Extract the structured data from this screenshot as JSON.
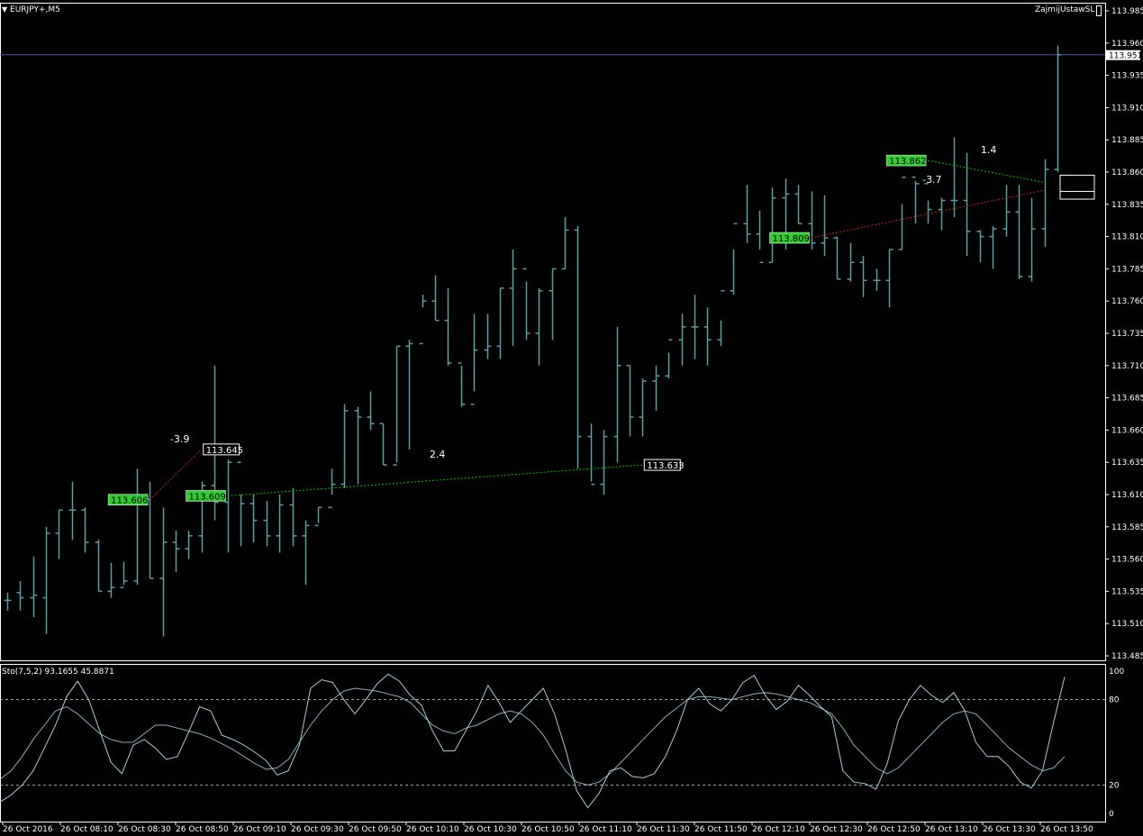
{
  "header": {
    "symbol_label": "EURJPY+,M5",
    "expert_name": "ZajmijUstawSL"
  },
  "indicator": {
    "label": "Sto(7,5,2) 93.1655 45.8871"
  },
  "colors": {
    "background": "#000000",
    "bar": "#5f9ea0",
    "axis_text": "#ffffff",
    "bid_line": "#4a5aa8",
    "buy_line": "#00c000",
    "sell_line": "#d02020",
    "level_line": "#cfcfcf",
    "open_label_bg": "#32cd32"
  },
  "chart_data": [
    {
      "type": "ohlc",
      "symbol": "EURJPY+",
      "timeframe": "M5",
      "price_ticks": [
        "113.985",
        "113.960",
        "113.935",
        "113.910",
        "113.885",
        "113.860",
        "113.835",
        "113.810",
        "113.785",
        "113.760",
        "113.735",
        "113.710",
        "113.685",
        "113.660",
        "113.635",
        "113.610",
        "113.585",
        "113.560",
        "113.535",
        "113.510",
        "113.485"
      ],
      "ylim": [
        113.48,
        113.99
      ],
      "current_price": "113.951",
      "time_ticks": [
        "26 Oct 2016",
        "26 Oct 08:10",
        "26 Oct 08:30",
        "26 Oct 08:50",
        "26 Oct 09:10",
        "26 Oct 09:30",
        "26 Oct 09:50",
        "26 Oct 10:10",
        "26 Oct 10:30",
        "26 Oct 10:50",
        "26 Oct 11:10",
        "26 Oct 11:30",
        "26 Oct 11:50",
        "26 Oct 12:10",
        "26 Oct 12:30",
        "26 Oct 12:50",
        "26 Oct 13:10",
        "26 Oct 13:30",
        "26 Oct 13:50"
      ],
      "ohlc": [
        [
          113.528,
          113.534,
          113.52,
          113.528
        ],
        [
          113.534,
          113.543,
          113.52,
          113.53
        ],
        [
          113.53,
          113.562,
          113.515,
          113.532
        ],
        [
          113.53,
          113.585,
          113.502,
          113.58
        ],
        [
          113.58,
          113.598,
          113.56,
          113.598
        ],
        [
          113.598,
          113.62,
          113.575,
          113.598
        ],
        [
          113.598,
          113.6,
          113.565,
          113.573
        ],
        [
          113.573,
          113.575,
          113.535,
          113.535
        ],
        [
          113.535,
          113.557,
          113.53,
          113.538
        ],
        [
          113.538,
          113.558,
          113.54,
          113.543
        ],
        [
          113.543,
          113.63,
          113.54,
          113.606
        ],
        [
          113.606,
          113.62,
          113.545,
          113.545
        ],
        [
          113.545,
          113.6,
          113.5,
          113.573
        ],
        [
          113.573,
          113.582,
          113.55,
          113.568
        ],
        [
          113.568,
          113.582,
          113.56,
          113.578
        ],
        [
          113.578,
          113.62,
          113.565,
          113.617
        ],
        [
          113.617,
          113.71,
          113.59,
          113.604
        ],
        [
          113.604,
          113.637,
          113.565,
          113.635
        ],
        [
          113.635,
          113.61,
          113.57,
          113.603
        ],
        [
          113.603,
          113.61,
          113.573,
          113.59
        ],
        [
          113.59,
          113.605,
          113.57,
          113.578
        ],
        [
          113.578,
          113.61,
          113.565,
          113.602
        ],
        [
          113.602,
          113.615,
          113.57,
          113.578
        ],
        [
          113.578,
          113.59,
          113.54,
          113.586
        ],
        [
          113.586,
          113.6,
          113.588,
          113.6
        ],
        [
          113.6,
          113.63,
          113.61,
          113.618
        ],
        [
          113.618,
          113.68,
          113.615,
          113.675
        ],
        [
          113.675,
          113.678,
          113.618,
          113.67
        ],
        [
          113.67,
          113.69,
          113.66,
          113.665
        ],
        [
          113.665,
          113.665,
          113.633,
          113.633
        ],
        [
          113.633,
          113.725,
          113.635,
          113.725
        ],
        [
          113.725,
          113.73,
          113.645,
          113.727
        ],
        [
          113.727,
          113.765,
          113.755,
          113.76
        ],
        [
          113.76,
          113.78,
          113.745,
          113.745
        ],
        [
          113.745,
          113.77,
          113.71,
          113.712
        ],
        [
          113.712,
          113.71,
          113.678,
          113.68
        ],
        [
          113.68,
          113.75,
          113.69,
          113.722
        ],
        [
          113.722,
          113.75,
          113.715,
          113.725
        ],
        [
          113.725,
          113.77,
          113.715,
          113.77
        ],
        [
          113.77,
          113.8,
          113.725,
          113.785
        ],
        [
          113.785,
          113.775,
          113.73,
          113.735
        ],
        [
          113.735,
          113.77,
          113.71,
          113.768
        ],
        [
          113.768,
          113.785,
          113.73,
          113.785
        ],
        [
          113.785,
          113.825,
          113.785,
          113.815
        ],
        [
          113.815,
          113.818,
          113.63,
          113.655
        ],
        [
          113.655,
          113.665,
          113.62,
          113.618
        ],
        [
          113.618,
          113.66,
          113.61,
          113.655
        ],
        [
          113.655,
          113.74,
          113.635,
          113.71
        ],
        [
          113.71,
          113.71,
          113.655,
          113.67
        ],
        [
          113.67,
          113.7,
          113.655,
          113.698
        ],
        [
          113.698,
          113.71,
          113.675,
          113.702
        ],
        [
          113.702,
          113.72,
          113.7,
          113.73
        ],
        [
          113.73,
          113.75,
          113.71,
          113.74
        ],
        [
          113.74,
          113.765,
          113.715,
          113.74
        ],
        [
          113.74,
          113.755,
          113.71,
          113.73
        ],
        [
          113.73,
          113.745,
          113.725,
          113.768
        ],
        [
          113.768,
          113.8,
          113.765,
          113.82
        ],
        [
          113.82,
          113.85,
          113.805,
          113.812
        ],
        [
          113.812,
          113.83,
          113.8,
          113.79
        ],
        [
          113.79,
          113.848,
          113.79,
          113.84
        ],
        [
          113.84,
          113.855,
          113.8,
          113.843
        ],
        [
          113.843,
          113.85,
          113.82,
          113.82
        ],
        [
          113.82,
          113.845,
          113.8,
          113.805
        ],
        [
          113.805,
          113.842,
          113.795,
          113.809
        ],
        [
          113.809,
          113.81,
          113.777,
          113.777
        ],
        [
          113.777,
          113.805,
          113.775,
          113.79
        ],
        [
          113.79,
          113.795,
          113.763,
          113.776
        ],
        [
          113.776,
          113.785,
          113.768,
          113.776
        ],
        [
          113.776,
          113.8,
          113.755,
          113.8
        ],
        [
          113.8,
          113.835,
          113.8,
          113.856
        ],
        [
          113.856,
          113.853,
          113.82,
          113.851
        ],
        [
          113.851,
          113.838,
          113.82,
          113.831
        ],
        [
          113.831,
          113.84,
          113.815,
          113.838
        ],
        [
          113.838,
          113.887,
          113.825,
          113.838
        ],
        [
          113.838,
          113.875,
          113.795,
          113.814
        ],
        [
          113.814,
          113.815,
          113.79,
          113.81
        ],
        [
          113.81,
          113.818,
          113.785,
          113.816
        ],
        [
          113.816,
          113.85,
          113.81,
          113.829
        ],
        [
          113.829,
          113.85,
          113.777,
          113.779
        ],
        [
          113.779,
          113.84,
          113.775,
          113.816
        ],
        [
          113.816,
          113.87,
          113.802,
          113.862
        ],
        [
          113.862,
          113.958,
          113.86,
          113.951
        ]
      ]
    },
    {
      "type": "line",
      "name": "Sto(7,5,2)",
      "ylim": [
        0,
        100
      ],
      "levels": [
        "80",
        "20"
      ],
      "y_ticks": [
        "100",
        "80",
        "20",
        "0"
      ],
      "main": [
        8,
        13,
        20,
        30,
        46,
        62,
        82,
        93,
        80,
        58,
        36,
        28,
        48,
        52,
        46,
        38,
        40,
        57,
        75,
        72,
        55,
        52,
        48,
        43,
        37,
        27,
        30,
        48,
        88,
        94,
        92,
        80,
        70,
        80,
        91,
        98,
        93,
        83,
        76,
        58,
        44,
        44,
        58,
        72,
        90,
        78,
        64,
        72,
        80,
        88,
        70,
        45,
        16,
        4,
        14,
        30,
        32,
        26,
        25,
        28,
        40,
        58,
        80,
        88,
        77,
        72,
        80,
        92,
        97,
        83,
        73,
        79,
        90,
        83,
        75,
        68,
        30,
        22,
        21,
        17,
        35,
        65,
        80,
        90,
        83,
        78,
        85,
        72,
        50,
        40,
        40,
        33,
        22,
        18,
        30,
        64,
        96
      ],
      "signal": [
        24,
        30,
        40,
        52,
        62,
        72,
        75,
        70,
        63,
        56,
        52,
        50,
        50,
        56,
        62,
        62,
        60,
        58,
        56,
        53,
        49,
        45,
        40,
        35,
        31,
        32,
        38,
        50,
        62,
        72,
        80,
        86,
        88,
        87,
        86,
        84,
        82,
        78,
        70,
        62,
        58,
        56,
        60,
        62,
        66,
        70,
        72,
        70,
        64,
        55,
        42,
        30,
        22,
        20,
        22,
        28,
        36,
        44,
        52,
        60,
        68,
        74,
        80,
        82,
        82,
        81,
        80,
        82,
        84,
        85,
        84,
        82,
        80,
        78,
        74,
        70,
        60,
        48,
        40,
        32,
        28,
        32,
        40,
        48,
        56,
        64,
        70,
        72,
        70,
        62,
        54,
        46,
        40,
        34,
        30,
        32,
        40
      ]
    }
  ],
  "trades": [
    {
      "open_label": "113.606",
      "close_label": "113.645",
      "profit_label": "-3.9",
      "side": "sell",
      "open_bar": 11,
      "close_bar": 15,
      "open_price": 113.606,
      "close_price": 113.645
    },
    {
      "open_label": "113.609",
      "close_label": "113.633",
      "profit_label": "2.4",
      "side": "buy",
      "open_bar": 17,
      "close_bar": 49,
      "open_price": 113.609,
      "close_price": 113.633
    },
    {
      "open_label": "113.809",
      "close_label": "",
      "profit_label": "-3.7",
      "side": "sell",
      "open_bar": 62,
      "close_bar": 80,
      "open_price": 113.809,
      "close_price": 113.846
    },
    {
      "open_label": "113.862",
      "close_label": "",
      "profit_label": "1.4",
      "side": "buy",
      "open_bar": 71,
      "close_bar": 80,
      "open_price": 113.869,
      "close_price": 113.852
    }
  ]
}
